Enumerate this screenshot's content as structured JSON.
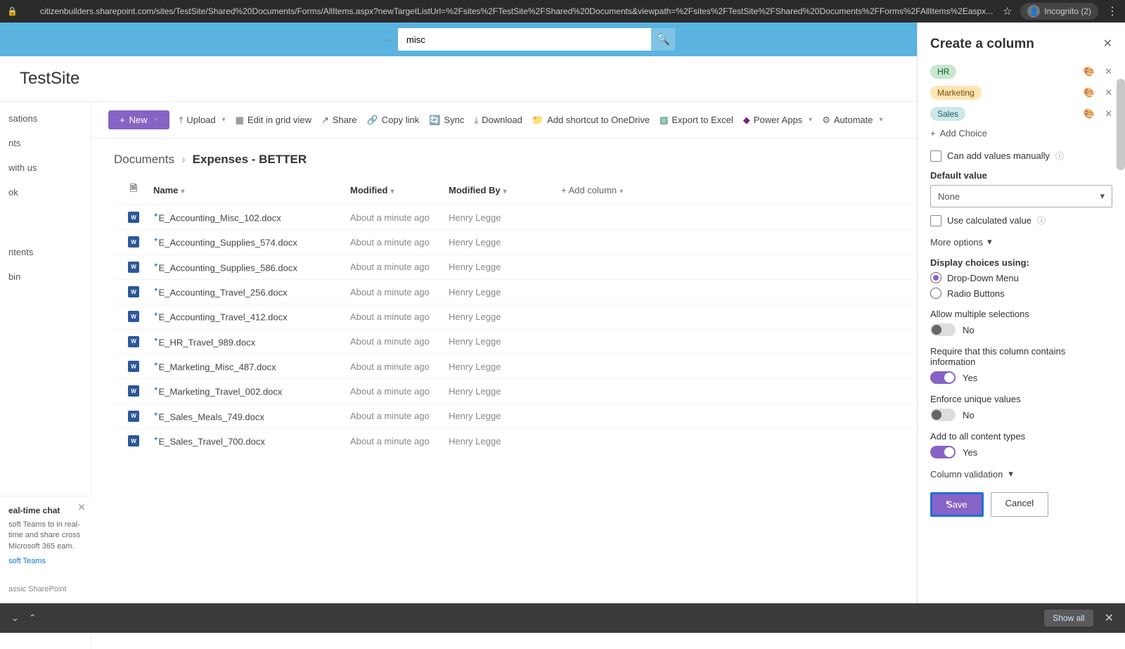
{
  "browser": {
    "url": "citizenbuilders.sharepoint.com/sites/TestSite/Shared%20Documents/Forms/AllItems.aspx?newTargetListUrl=%2Fsites%2FTestSite%2FShared%20Documents&viewpath=%2Fsites%2FTestSite%2FShared%20Documents%2FForms%2FAllItems%2Easpx...",
    "incognito": "Incognito (2)"
  },
  "search": {
    "value": "misc"
  },
  "site": {
    "title": "TestSite"
  },
  "nav": {
    "items": [
      "sations",
      "nts",
      "with us",
      "ok",
      "",
      "ntents",
      "bin"
    ]
  },
  "toolbar": {
    "new": "New",
    "upload": "Upload",
    "editgrid": "Edit in grid view",
    "share": "Share",
    "copylink": "Copy link",
    "sync": "Sync",
    "download": "Download",
    "shortcut": "Add shortcut to OneDrive",
    "excel": "Export to Excel",
    "powerapps": "Power Apps",
    "automate": "Automate"
  },
  "breadcrumb": {
    "root": "Documents",
    "cur": "Expenses - BETTER"
  },
  "columns": {
    "name": "Name",
    "modified": "Modified",
    "by": "Modified By",
    "add": "Add column"
  },
  "rows": [
    {
      "name": "E_Accounting_Misc_102.docx",
      "mod": "About a minute ago",
      "by": "Henry Legge"
    },
    {
      "name": "E_Accounting_Supplies_574.docx",
      "mod": "About a minute ago",
      "by": "Henry Legge"
    },
    {
      "name": "E_Accounting_Supplies_586.docx",
      "mod": "About a minute ago",
      "by": "Henry Legge"
    },
    {
      "name": "E_Accounting_Travel_256.docx",
      "mod": "About a minute ago",
      "by": "Henry Legge"
    },
    {
      "name": "E_Accounting_Travel_412.docx",
      "mod": "About a minute ago",
      "by": "Henry Legge"
    },
    {
      "name": "E_HR_Travel_989.docx",
      "mod": "About a minute ago",
      "by": "Henry Legge"
    },
    {
      "name": "E_Marketing_Misc_487.docx",
      "mod": "About a minute ago",
      "by": "Henry Legge"
    },
    {
      "name": "E_Marketing_Travel_002.docx",
      "mod": "About a minute ago",
      "by": "Henry Legge"
    },
    {
      "name": "E_Sales_Meals_749.docx",
      "mod": "About a minute ago",
      "by": "Henry Legge"
    },
    {
      "name": "E_Sales_Travel_700.docx",
      "mod": "About a minute ago",
      "by": "Henry Legge"
    }
  ],
  "chat": {
    "title": "eal-time chat",
    "body": "soft Teams to in real-time and share cross Microsoft 365 eam.",
    "link": "soft Teams",
    "classic": "assic SharePoint"
  },
  "panel": {
    "title": "Create a column",
    "choices": [
      "HR",
      "Marketing",
      "Sales"
    ],
    "addchoice": "Add Choice",
    "manual": "Can add values manually",
    "default": "Default value",
    "defaultval": "None",
    "calc": "Use calculated value",
    "more": "More options",
    "display": "Display choices using:",
    "dropdown": "Drop-Down Menu",
    "radio": "Radio Buttons",
    "multi": "Allow multiple selections",
    "require": "Require that this column contains information",
    "unique": "Enforce unique values",
    "contenttypes": "Add to all content types",
    "validation": "Column validation",
    "yes": "Yes",
    "no": "No",
    "save": "Save",
    "cancel": "Cancel"
  },
  "bottombar": {
    "showall": "Show all"
  }
}
